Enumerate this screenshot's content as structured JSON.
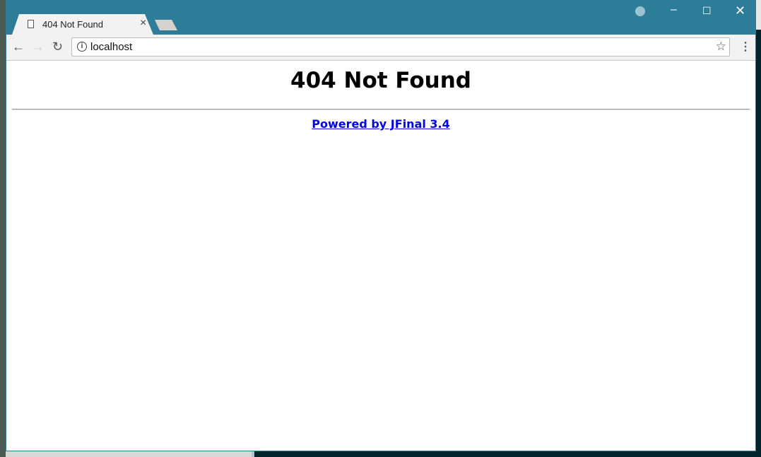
{
  "browser": {
    "tab_title": "404 Not Found",
    "url": "localhost",
    "theme_color": "#2d7d99"
  },
  "page": {
    "heading": "404 Not Found",
    "footer_link": "Powered by JFinal 3.4",
    "link_color": "#0000ee"
  }
}
